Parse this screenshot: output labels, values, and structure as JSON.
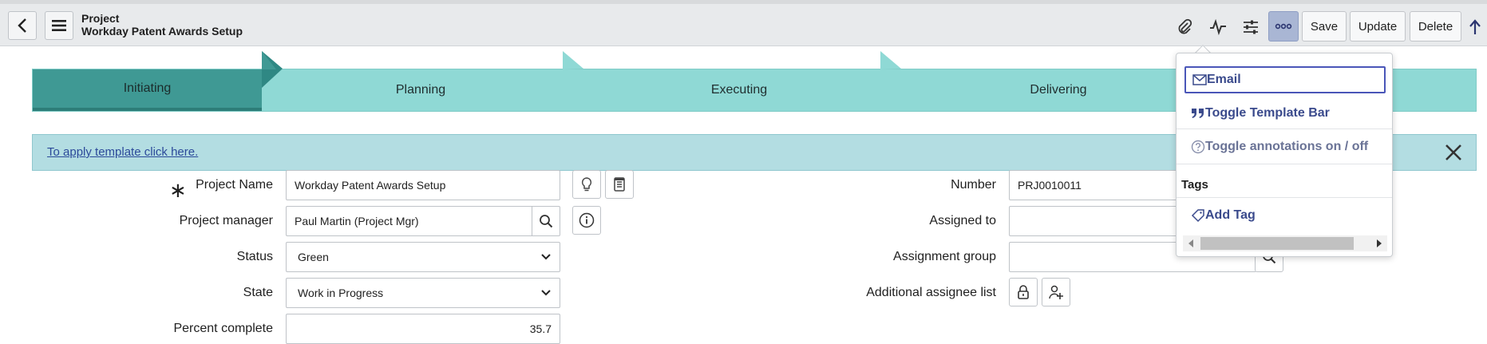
{
  "header": {
    "record_type": "Project",
    "record_name": "Workday Patent Awards Setup",
    "actions": {
      "save": "Save",
      "update": "Update",
      "delete": "Delete"
    }
  },
  "process_flow": {
    "stages": [
      "Initiating",
      "Planning",
      "Executing",
      "Delivering"
    ],
    "current": "Initiating"
  },
  "template_bar": {
    "link_text": "To apply template click here."
  },
  "form": {
    "project_name": {
      "label": "Project Name",
      "value": "Workday Patent Awards Setup"
    },
    "project_manager": {
      "label": "Project manager",
      "value": "Paul Martin (Project Mgr)"
    },
    "status": {
      "label": "Status",
      "value": "Green"
    },
    "state": {
      "label": "State",
      "value": "Work in Progress"
    },
    "percent_complete": {
      "label": "Percent complete",
      "value": "35.7"
    },
    "number": {
      "label": "Number",
      "value": "PRJ0010011"
    },
    "assigned_to": {
      "label": "Assigned to",
      "value": ""
    },
    "assignment_group": {
      "label": "Assignment group",
      "value": ""
    },
    "additional_assignee": {
      "label": "Additional assignee list"
    }
  },
  "menu": {
    "items": [
      {
        "label": "Email",
        "icon": "envelope-icon"
      },
      {
        "label": "Toggle Template Bar",
        "icon": "quote-icon"
      },
      {
        "label": "Toggle annotations on / off",
        "icon": "help-circle-icon"
      }
    ],
    "tags_heading": "Tags",
    "add_tag": {
      "label": "Add Tag",
      "icon": "tag-icon"
    }
  },
  "colors": {
    "accent": "#3a4a8c",
    "flow_current": "#3f9994",
    "flow_other": "#8fd9d5",
    "template_bar": "#b3dde2"
  }
}
